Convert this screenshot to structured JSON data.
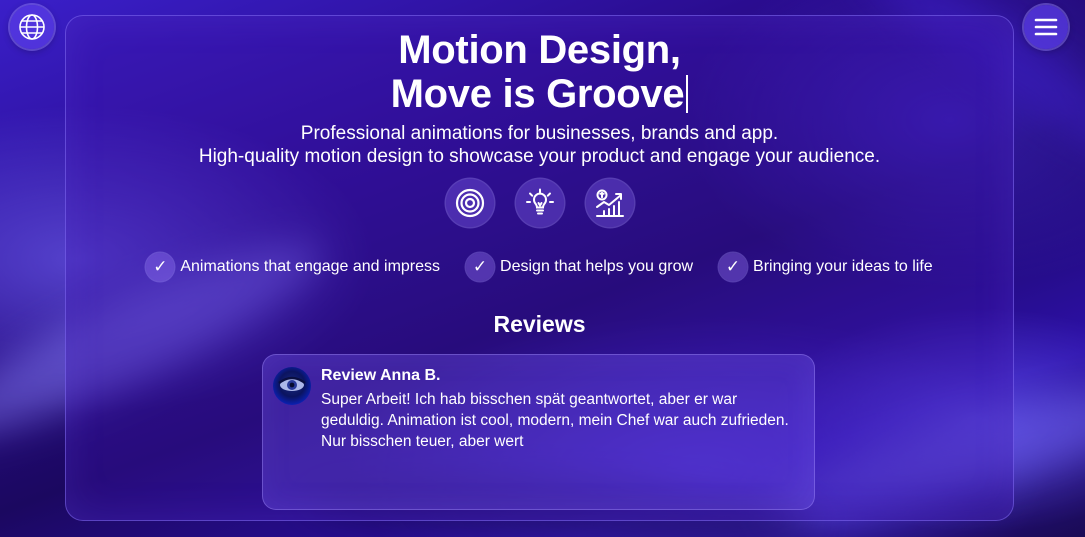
{
  "header": {
    "title_line1": "Motion Design,",
    "title_line2": "Move is Groove",
    "subtitle_line1": "Professional animations for businesses, brands and app.",
    "subtitle_line2": "High-quality motion design to showcase your product and engage your audience."
  },
  "nav": {
    "language_icon": "globe-icon",
    "menu_icon": "hamburger-menu-icon"
  },
  "features": {
    "icons": [
      "target-icon",
      "lightbulb-icon",
      "growth-chart-icon"
    ],
    "bullets": [
      "Animations that engage and impress",
      "Design that helps you grow",
      "Bringing your ideas to life"
    ],
    "check_glyph": "✓"
  },
  "reviews": {
    "heading": "Reviews",
    "items": [
      {
        "name": "Review Anna B.",
        "text": "Super Arbeit! Ich hab bisschen spät geantwortet, aber er war geduldig. Animation ist cool, modern, mein Chef war auch zufrieden. Nur bisschen teuer, aber wert"
      }
    ]
  },
  "colors": {
    "background_primary": "#2a0c8f",
    "background_accent": "#3a1fc9",
    "panel_border": "#8c78ff",
    "text": "#ffffff"
  }
}
